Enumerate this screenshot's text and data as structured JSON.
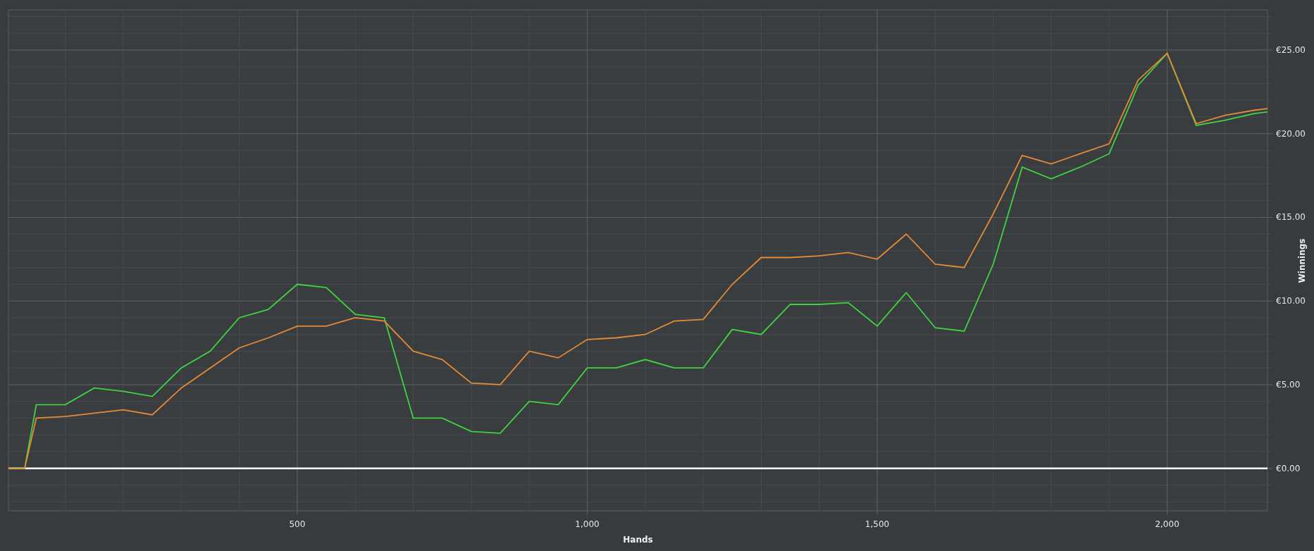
{
  "chart_data": {
    "type": "line",
    "grid": true,
    "xlabel": "Hands",
    "ylabel": "Winnings",
    "xlim": [
      2,
      2173
    ],
    "ylim": [
      -2.54,
      27.4
    ],
    "xticks": [
      {
        "value": 500,
        "label": "500"
      },
      {
        "value": 1000,
        "label": "1,000"
      },
      {
        "value": 1500,
        "label": "1,500"
      },
      {
        "value": 2000,
        "label": "2,000"
      }
    ],
    "yticks": [
      {
        "value": 0,
        "label": "€0.00"
      },
      {
        "value": 5,
        "label": "€5.00"
      },
      {
        "value": 10,
        "label": "€10.00"
      },
      {
        "value": 15,
        "label": "€15.00"
      },
      {
        "value": 20,
        "label": "€20.00"
      },
      {
        "value": 25,
        "label": "€25.00"
      }
    ],
    "x": [
      2,
      30,
      50,
      100,
      150,
      200,
      250,
      300,
      350,
      400,
      450,
      500,
      550,
      600,
      650,
      700,
      750,
      800,
      850,
      900,
      950,
      1000,
      1050,
      1100,
      1150,
      1200,
      1250,
      1300,
      1350,
      1400,
      1450,
      1500,
      1550,
      1600,
      1650,
      1700,
      1750,
      1800,
      1850,
      1900,
      1950,
      2000,
      2050,
      2100,
      2150,
      2173
    ],
    "series": [
      {
        "color": "#3fd43f",
        "values": [
          0,
          0,
          3.8,
          3.8,
          4.8,
          4.6,
          4.3,
          6.0,
          7.0,
          9.0,
          9.5,
          11.0,
          10.8,
          9.2,
          9.0,
          3.0,
          3.0,
          2.2,
          2.1,
          4.0,
          3.8,
          6.0,
          6.0,
          6.5,
          6.0,
          6.0,
          8.3,
          8.0,
          9.8,
          9.8,
          9.9,
          8.5,
          10.5,
          8.4,
          8.2,
          12.2,
          18.0,
          17.3,
          18.0,
          18.8,
          22.9,
          24.8,
          20.5,
          20.8,
          21.2,
          21.3
        ]
      },
      {
        "color": "#e68a35",
        "values": [
          0,
          0,
          3.0,
          3.1,
          3.3,
          3.5,
          3.2,
          4.8,
          6.0,
          7.2,
          7.8,
          8.5,
          8.5,
          9.0,
          8.8,
          7.0,
          6.5,
          5.1,
          5.0,
          7.0,
          6.6,
          7.7,
          7.8,
          8.0,
          8.8,
          8.9,
          11.0,
          12.6,
          12.6,
          12.7,
          12.9,
          12.5,
          14.0,
          12.2,
          12.0,
          15.2,
          18.7,
          18.2,
          18.8,
          19.4,
          23.2,
          24.8,
          20.6,
          21.1,
          21.4,
          21.5
        ]
      }
    ]
  }
}
